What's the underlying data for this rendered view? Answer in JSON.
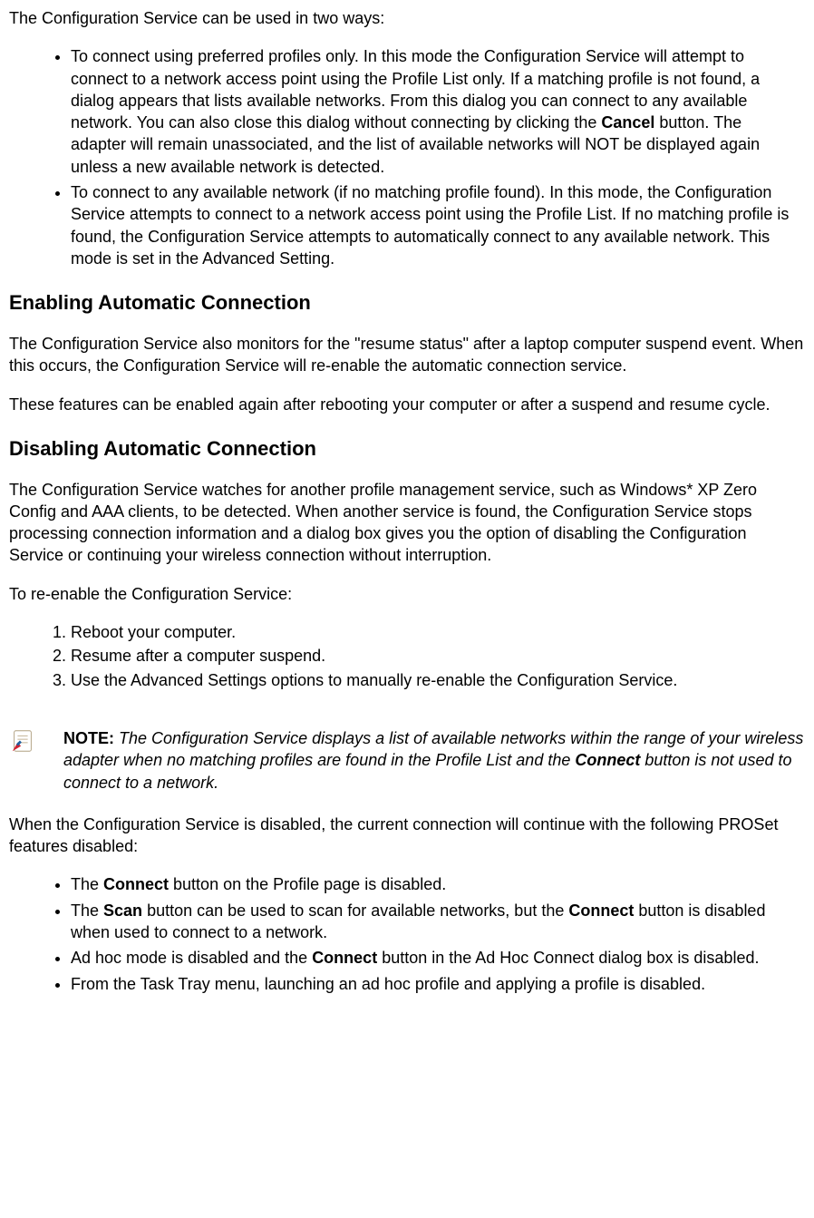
{
  "intro": "The Configuration Service can be used in two ways:",
  "mode_list": [
    {
      "pre": "To connect using preferred profiles only. In this mode the Configuration Service will attempt to connect to a network access point using the Profile List only. If a matching profile is not found, a dialog appears that lists available networks. From this dialog you can connect to any available network. You can also close this dialog without connecting by clicking the ",
      "bold": "Cancel",
      "post": " button. The adapter will remain unassociated, and the list of available networks will NOT be displayed again unless a new available network is detected."
    },
    {
      "pre": "To connect to any available network (if no matching profile found). In this mode, the Configuration Service attempts to connect to a network access point using the Profile List. If no matching profile is found, the Configuration Service attempts to automatically connect to any available network. This mode is set in the Advanced Setting.",
      "bold": "",
      "post": ""
    }
  ],
  "enabling_heading": "Enabling Automatic Connection",
  "enabling_p1": "The Configuration Service also monitors for the \"resume status\" after a laptop computer suspend event. When this occurs, the Configuration Service will re-enable the automatic connection service.",
  "enabling_p2": "These features can be enabled again after rebooting your computer or after a suspend and resume cycle.",
  "disabling_heading": "Disabling Automatic Connection",
  "disabling_p1": "The Configuration Service watches for another profile management service, such as Windows* XP Zero Config and AAA clients, to be detected. When another service is found, the Configuration Service stops processing connection information and a dialog box gives you the option of disabling the Configuration Service or continuing your wireless connection without interruption.",
  "reenable_intro": "To re-enable the Configuration Service:",
  "reenable_steps": [
    "Reboot your computer.",
    "Resume after a computer suspend.",
    "Use the Advanced Settings options to manually re-enable the Configuration Service."
  ],
  "note": {
    "label": "NOTE:",
    "pre": " The Configuration Service displays a list of available networks within the range of your wireless adapter when no matching profiles are found in the Profile List and the ",
    "bold": "Connect",
    "post": " button is not used to connect to a network."
  },
  "disabled_intro": "When the Configuration Service is disabled, the current connection will continue with the following PROSet features disabled:",
  "disabled_list": [
    {
      "pre": "The ",
      "b1": "Connect",
      "mid": " button on the Profile page is disabled.",
      "b2": "",
      "post": ""
    },
    {
      "pre": "The ",
      "b1": "Scan",
      "mid": " button can be used to scan for available networks, but the ",
      "b2": "Connect",
      "post": " button is disabled when used to connect to a network."
    },
    {
      "pre": "Ad hoc mode is disabled and the ",
      "b1": "Connect",
      "mid": " button in the Ad Hoc Connect dialog box is disabled.",
      "b2": "",
      "post": ""
    },
    {
      "pre": "From the Task Tray menu, launching an ad hoc profile and applying a profile is disabled.",
      "b1": "",
      "mid": "",
      "b2": "",
      "post": ""
    }
  ]
}
